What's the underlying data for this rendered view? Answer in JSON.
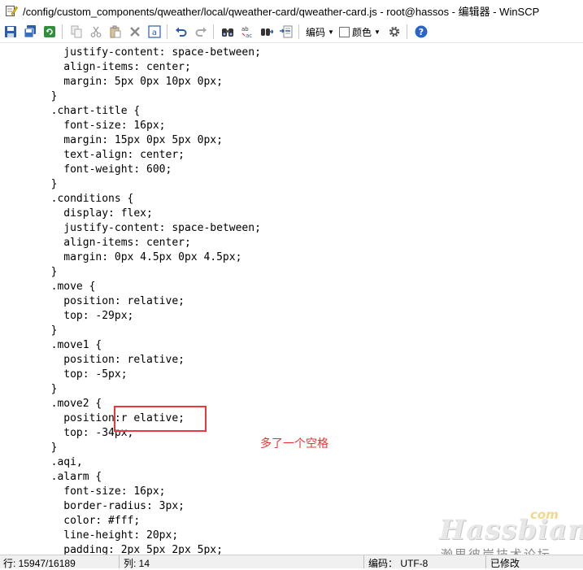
{
  "window": {
    "title": "/config/custom_components/qweather/local/qweather-card/qweather-card.js - root@hassos - 编辑器 - WinSCP"
  },
  "toolbar": {
    "encoding_label": "编码",
    "color_label": "颜色",
    "icons": [
      "save-icon",
      "save-all-icon",
      "refresh-icon",
      "copy-icon",
      "cut-icon",
      "paste-icon",
      "delete-icon",
      "select-all-icon",
      "undo-icon",
      "redo-icon",
      "find-icon",
      "replace-icon",
      "find-next-icon",
      "goto-line-icon",
      "settings-icon",
      "help-icon"
    ]
  },
  "editor": {
    "lines": [
      "          justify-content: space-between;",
      "          align-items: center;",
      "          margin: 5px 0px 10px 0px;",
      "        }",
      "        .chart-title {",
      "          font-size: 16px;",
      "          margin: 15px 0px 5px 0px;",
      "          text-align: center;",
      "          font-weight: 600;",
      "        }",
      "        .conditions {",
      "          display: flex;",
      "          justify-content: space-between;",
      "          align-items: center;",
      "          margin: 0px 4.5px 0px 4.5px;",
      "        }",
      "        .move {",
      "          position: relative;",
      "          top: -29px;",
      "        }",
      "        .move1 {",
      "          position: relative;",
      "          top: -5px;",
      "        }",
      "        .move2 {",
      "          position:r elative;",
      "          top: -34px;",
      "        }",
      "        .aqi,",
      "        .alarm {",
      "          font-size: 16px;",
      "          border-radius: 3px;",
      "          color: #fff;",
      "          line-height: 20px;",
      "          padding: 2px 5px 2px 5px;"
    ]
  },
  "annotation": {
    "text": "多了一个空格",
    "color": "#e8342f"
  },
  "watermark": {
    "brand": "Hassbian",
    "domain": "com",
    "tagline": "瀚思彼岸技术论坛"
  },
  "statusbar": {
    "line": "行: 15947/16189",
    "column": "列: 14",
    "encoding": "编码： UTF-8",
    "modified": "已修改"
  }
}
